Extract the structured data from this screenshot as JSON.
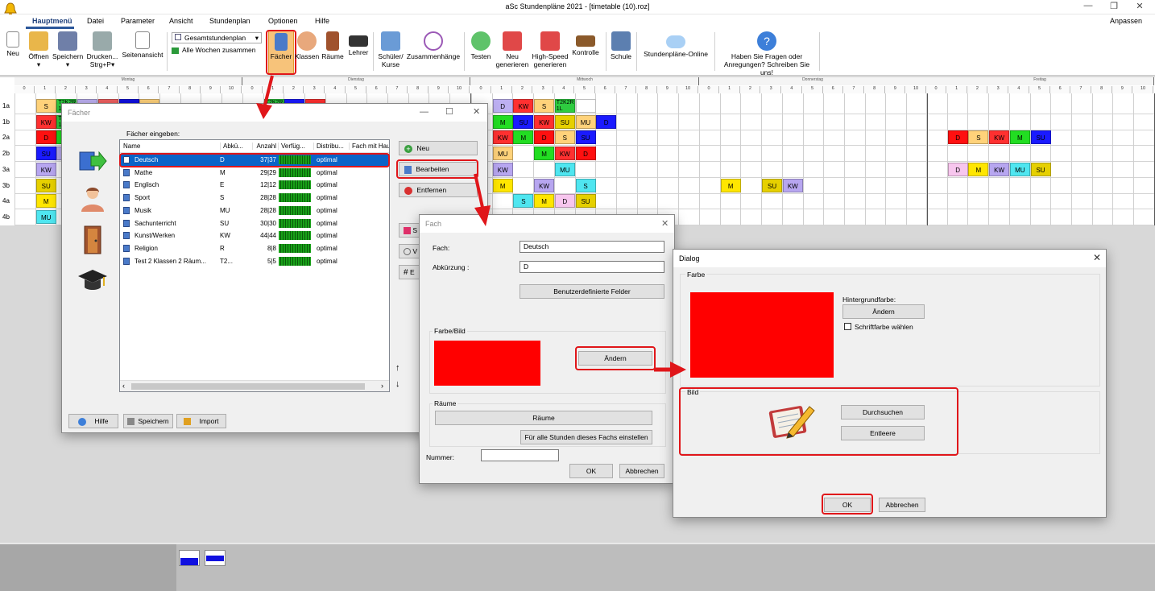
{
  "app": {
    "title": "aSc Stundenpläne 2021  - [timetable (10).roz]",
    "customize": "Anpassen"
  },
  "menu": {
    "items": [
      "Hauptmenü",
      "Datei",
      "Parameter",
      "Ansicht",
      "Stundenplan",
      "Optionen",
      "Hilfe"
    ]
  },
  "ribbon": {
    "neu": "Neu",
    "offnen": "Öffnen",
    "speichern": "Speichern",
    "drucken": "Drucken...",
    "drucken_sub": "Strg+P",
    "seitenansicht": "Seitenansicht",
    "combo1": "Gesamtstundenplan",
    "combo2": "Alle Wochen zusammen",
    "facher": "Fächer",
    "klassen": "Klassen",
    "raume": "Räume",
    "lehrer": "Lehrer",
    "schuler": "Schüler/",
    "kurse": "Kurse",
    "zusammenhange": "Zusammenhänge",
    "testen": "Testen",
    "neu_gen": "Neu",
    "generieren": "generieren",
    "highspeed": "High-Speed",
    "generieren2": "generieren",
    "kontrolle": "Kontrolle",
    "schule": "Schule",
    "online": "Stundenpläne-Online",
    "fragen1": "Haben Sie Fragen oder",
    "fragen2": "Anregungen? Schreiben Sie uns!"
  },
  "timetable": {
    "days": [
      "Montag",
      "Dienstag",
      "Mittwoch",
      "Donnerstag",
      "Freitag"
    ],
    "periods": [
      "0",
      "1",
      "2",
      "3",
      "4",
      "5",
      "6",
      "7",
      "8",
      "9",
      "10"
    ],
    "classes": [
      "1a",
      "1b",
      "2a",
      "2b",
      "3a",
      "3b",
      "4a",
      "4b"
    ],
    "cells": [
      {
        "t": "S",
        "c": "#ffd27a"
      },
      {
        "t": "T2K2R",
        "c": "#2ecc40",
        "s": "1L"
      },
      {
        "t": "D",
        "c": "#bdb0f2"
      },
      {
        "t": "KW",
        "c": "#f06060"
      },
      {
        "t": "",
        "c": "#1010e0"
      },
      {
        "t": "MU",
        "c": "#ffd27a"
      },
      {
        "t": "KW",
        "c": "#ff3030"
      },
      {
        "t": "T2K2R",
        "c": "#2ecc40",
        "s": "1L"
      },
      {
        "t": "MU",
        "c": "#ffd27a"
      },
      {
        "t": "D",
        "c": "#ff1010"
      },
      {
        "t": "M",
        "c": "#22dd22"
      },
      {
        "t": "SU",
        "c": "#1a1aff"
      },
      {
        "t": "D",
        "c": "#bdb0f2"
      },
      {
        "t": "KW",
        "c": "#b7a6f0"
      },
      {
        "t": "SU",
        "c": "#e6d000"
      },
      {
        "t": "M",
        "c": "#ffe600"
      },
      {
        "t": "MU",
        "c": "#4fe6f0"
      },
      {
        "t": "T2K2R",
        "c": "#2ecc40",
        "s": "1L"
      },
      {
        "t": "D",
        "c": "#1a1aff"
      },
      {
        "t": "KW",
        "c": "#ff3030"
      },
      {
        "t": "D",
        "c": "#bdb0f2"
      },
      {
        "t": "KW",
        "c": "#ff3030"
      },
      {
        "t": "S",
        "c": "#ffd27a"
      },
      {
        "t": "T2K2R",
        "c": "#2ecc40",
        "s": "1L"
      },
      {
        "t": "",
        "c": "#ffffff"
      },
      {
        "t": "M",
        "c": "#22dd22"
      },
      {
        "t": "SU",
        "c": "#1a1aff"
      },
      {
        "t": "KW",
        "c": "#ff3030"
      },
      {
        "t": "SU",
        "c": "#e6d000"
      },
      {
        "t": "MU",
        "c": "#ffd27a"
      },
      {
        "t": "D",
        "c": "#1a1aff"
      },
      {
        "t": "KW",
        "c": "#ff3030"
      },
      {
        "t": "M",
        "c": "#22dd22"
      },
      {
        "t": "D",
        "c": "#ff1010"
      },
      {
        "t": "S",
        "c": "#ffd27a"
      },
      {
        "t": "SU",
        "c": "#1a1aff"
      },
      {
        "t": "MU",
        "c": "#ffd27a"
      },
      {
        "t": "M",
        "c": "#22dd22"
      },
      {
        "t": "KW",
        "c": "#ff3030"
      },
      {
        "t": "D",
        "c": "#ff1010"
      },
      {
        "t": "KW",
        "c": "#b7a6f0"
      },
      {
        "t": "MU",
        "c": "#4fe6f0"
      },
      {
        "t": "M",
        "c": "#ffe600"
      },
      {
        "t": "KW",
        "c": "#b7a6f0"
      },
      {
        "t": "S",
        "c": "#4fe6f0"
      },
      {
        "t": "S",
        "c": "#4fe6f0"
      },
      {
        "t": "M",
        "c": "#ffe600"
      },
      {
        "t": "D",
        "c": "#f7c6ee"
      },
      {
        "t": "SU",
        "c": "#e6d000"
      },
      {
        "t": "M",
        "c": "#ffe600"
      },
      {
        "t": "SU",
        "c": "#e6d000"
      },
      {
        "t": "KW",
        "c": "#b7a6f0"
      },
      {
        "t": "D",
        "c": "#ff1010"
      },
      {
        "t": "S",
        "c": "#ffd27a"
      },
      {
        "t": "KW",
        "c": "#ff3030"
      },
      {
        "t": "M",
        "c": "#22dd22"
      },
      {
        "t": "SU",
        "c": "#1a1aff"
      },
      {
        "t": "D",
        "c": "#f7c6ee"
      },
      {
        "t": "M",
        "c": "#ffe600"
      },
      {
        "t": "KW",
        "c": "#b7a6f0"
      },
      {
        "t": "MU",
        "c": "#4fe6f0"
      },
      {
        "t": "SU",
        "c": "#e6d000"
      }
    ]
  },
  "facher_dialog": {
    "title": "Fächer",
    "enter": "Fächer eingeben:",
    "columns": [
      "Name",
      "Abkü...",
      "Anzahl",
      "Verfüg...",
      "Distribu...",
      "Fach mit Hau"
    ],
    "rows": [
      {
        "name": "Deutsch",
        "abbr": "D",
        "count": "37|37",
        "dist": "optimal"
      },
      {
        "name": "Mathe",
        "abbr": "M",
        "count": "29|29",
        "dist": "optimal"
      },
      {
        "name": "Englisch",
        "abbr": "E",
        "count": "12|12",
        "dist": "optimal"
      },
      {
        "name": "Sport",
        "abbr": "S",
        "count": "28|28",
        "dist": "optimal"
      },
      {
        "name": "Musik",
        "abbr": "MU",
        "count": "28|28",
        "dist": "optimal"
      },
      {
        "name": "Sachunterricht",
        "abbr": "SU",
        "count": "30|30",
        "dist": "optimal"
      },
      {
        "name": "Kunst/Werken",
        "abbr": "KW",
        "count": "44|44",
        "dist": "optimal"
      },
      {
        "name": "Religion",
        "abbr": "R",
        "count": "8|8",
        "dist": "optimal"
      },
      {
        "name": "Test 2 Klassen 2 Räum...",
        "abbr": "T2...",
        "count": "5|5",
        "dist": "optimal"
      }
    ],
    "neu": "Neu",
    "bearbeiten": "Bearbeiten",
    "entfernen": "Entfernen",
    "s": "S",
    "v": "V",
    "e": "E",
    "hilfe": "Hilfe",
    "speichern": "Speichern",
    "import": "Import"
  },
  "fach_dialog": {
    "title": "Fach",
    "fach_label": "Fach:",
    "fach_value": "Deutsch",
    "abk_label": "Abkürzung :",
    "abk_value": "D",
    "benutzer": "Benutzerdefinierte Felder",
    "farbe_bild": "Farbe/Bild",
    "andern": "Ändern",
    "raume": "Räume",
    "raume_btn": "Räume",
    "alle_stunden": "Für alle Stunden dieses Fachs einstellen",
    "nummer": "Nummer:",
    "ok": "OK",
    "abbrechen": "Abbrechen",
    "color": "#ff0000"
  },
  "dialog": {
    "title": "Dialog",
    "farbe": "Farbe",
    "hintergrund": "Hintergrundfarbe:",
    "andern": "Ändern",
    "schriftfarbe": "Schriftfarbe wählen",
    "bild": "Bild",
    "durchsuchen": "Durchsuchen",
    "entleere": "Entleere",
    "ok": "OK",
    "abbrechen": "Abbrechen",
    "color": "#ff0000"
  }
}
